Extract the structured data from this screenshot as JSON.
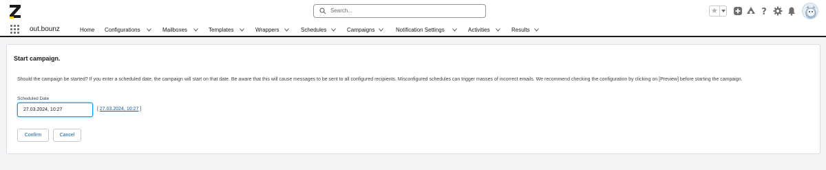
{
  "header": {
    "search_placeholder": "Search...",
    "icons": [
      "logo",
      "search-icon",
      "star-icon",
      "add-icon",
      "trailhead-icon",
      "help-icon",
      "settings-icon",
      "bell-icon",
      "avatar"
    ]
  },
  "nav": {
    "app_name": "out.bounz",
    "items": [
      {
        "label": "Home",
        "has_menu": false
      },
      {
        "label": "Configurations",
        "has_menu": true
      },
      {
        "label": "Mailboxes",
        "has_menu": true
      },
      {
        "label": "Templates",
        "has_menu": true
      },
      {
        "label": "Wrappers",
        "has_menu": true
      },
      {
        "label": "Schedules",
        "has_menu": true
      },
      {
        "label": "Campaigns",
        "has_menu": true
      },
      {
        "label": "Notification Settings",
        "has_menu": true
      },
      {
        "label": "Activities",
        "has_menu": true
      },
      {
        "label": "Results",
        "has_menu": true
      }
    ]
  },
  "card": {
    "title": "Start campaign.",
    "description": "Should the campaign be started? If you enter a scheduled date, the campaign will start on that date. Be aware that this will cause messages to be sent to all configured recipients. Misconfigured schedules can trigger masses of incorrect emails. We recommend checking the configuration by clicking on [Preview] before starting the campaign.",
    "scheduled_date_label": "Scheduled Date",
    "scheduled_date_value": "27.03.2024, 10:27",
    "bracket_open": "[ ",
    "date_link": "27.03.2024, 10:27",
    "bracket_close": " ]",
    "confirm_label": "Confirm",
    "cancel_label": "Cancel"
  },
  "colors": {
    "accent": "#0b5cab",
    "focus": "#1b96ff",
    "background": "#f3f3f3"
  }
}
